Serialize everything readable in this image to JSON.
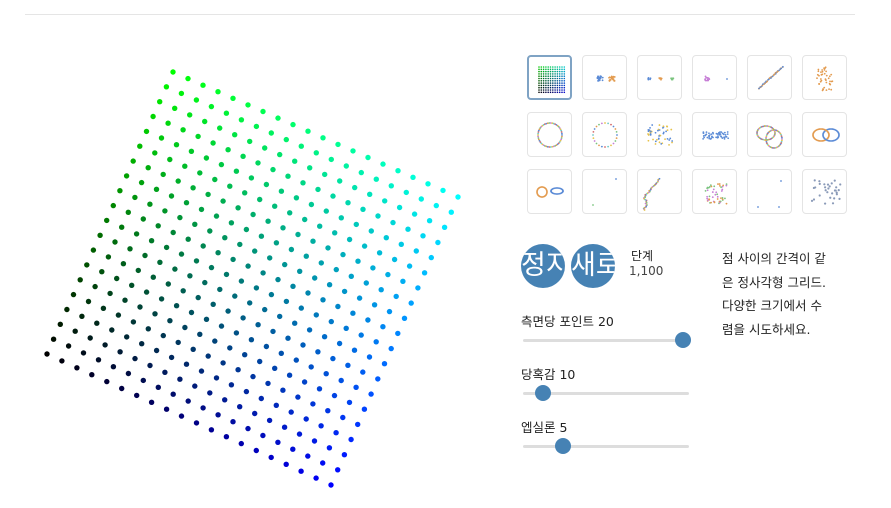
{
  "thumbnails": [
    {
      "name": "square-grid",
      "selected": true
    },
    {
      "name": "two-clusters"
    },
    {
      "name": "three-clusters"
    },
    {
      "name": "cluster-pair"
    },
    {
      "name": "parallel-lines"
    },
    {
      "name": "trefoil"
    },
    {
      "name": "circle"
    },
    {
      "name": "dotted-circle"
    },
    {
      "name": "gaussian-cloud"
    },
    {
      "name": "long-gaussian"
    },
    {
      "name": "linked-rings"
    },
    {
      "name": "unlinked-rings"
    },
    {
      "name": "orthogonal-rings"
    },
    {
      "name": "random-jitter"
    },
    {
      "name": "random-walk"
    },
    {
      "name": "simplex-clusters"
    },
    {
      "name": "sparse-points"
    },
    {
      "name": "subset-clusters"
    }
  ],
  "controls": {
    "pause_icon": "정지",
    "restart_icon": "새로",
    "step_label": "단계",
    "step_value": "1,100"
  },
  "sliders": [
    {
      "label": "측면당 포인트 20",
      "value": 20,
      "min": 5,
      "max": 20
    },
    {
      "label": "당혹감 10",
      "value": 10,
      "min": 2,
      "max": 100
    },
    {
      "label": "엡실론 5",
      "value": 5,
      "min": 1,
      "max": 20
    }
  ],
  "description": [
    "점 사이의 간격이 같",
    "은 정사각형 그리드.",
    "다양한 크기에서 수",
    "렴을 시도하세요."
  ],
  "colors": {
    "accent": "#4682b4",
    "track": "#dddddd",
    "thumb_border": "#e4e4e4",
    "selected_border": "#7fa3c4"
  },
  "plot": {
    "points_per_side": 20
  }
}
